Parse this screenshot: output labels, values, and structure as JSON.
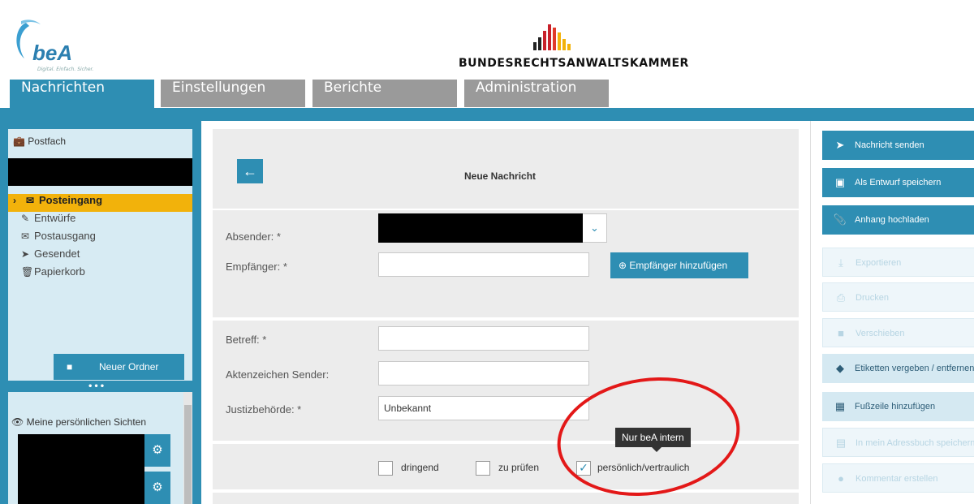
{
  "header": {
    "logo_text": "beA",
    "logo_subtitle": "Digital. Einfach. Sicher.",
    "org_name": "BUNDESRECHTSANWALTSKAMMER",
    "brand_color": "#2e8eb3",
    "accent_color": "#f2b20b"
  },
  "tabs": [
    {
      "label": "Nachrichten"
    },
    {
      "label": "Einstellungen"
    },
    {
      "label": "Berichte"
    },
    {
      "label": "Administration"
    }
  ],
  "sidebar": {
    "postfach_title": "Postfach",
    "folders": [
      {
        "label": "Posteingang",
        "icon": "envelope-icon"
      },
      {
        "label": "Entwürfe",
        "icon": "edit-icon"
      },
      {
        "label": "Postausgang",
        "icon": "open-envelope-icon"
      },
      {
        "label": "Gesendet",
        "icon": "send-icon"
      },
      {
        "label": "Papierkorb",
        "icon": "trash-icon"
      }
    ],
    "new_folder_label": "Neuer Ordner",
    "views_title": "Meine persönlichen Sichten"
  },
  "form": {
    "title": "Neue Nachricht",
    "absender_label": "Absender: *",
    "empfaenger_label": "Empfänger: *",
    "add_recipient_label": "Empfänger hinzufügen",
    "betreff_label": "Betreff: *",
    "aktenzeichen_label": "Aktenzeichen Sender:",
    "justiz_label": "Justizbehörde: *",
    "justiz_value": "Unbekannt",
    "checkboxes": [
      {
        "label": "dringend",
        "checked": false
      },
      {
        "label": "zu prüfen",
        "checked": false
      },
      {
        "label": "persönlich/vertraulich",
        "checked": true
      }
    ],
    "tooltip": "Nur beA intern"
  },
  "actions": [
    {
      "label": "Nachricht senden",
      "icon": "paper-plane-icon",
      "state": "primary"
    },
    {
      "label": "Als Entwurf speichern",
      "icon": "save-icon",
      "state": "primary"
    },
    {
      "label": "Anhang hochladen",
      "icon": "paperclip-icon",
      "state": "primary"
    },
    {
      "label": "Exportieren",
      "icon": "download-icon",
      "state": "disabled"
    },
    {
      "label": "Drucken",
      "icon": "printer-icon",
      "state": "disabled"
    },
    {
      "label": "Verschieben",
      "icon": "folder-move-icon",
      "state": "disabled"
    },
    {
      "label": "Etiketten vergeben / entfernen",
      "icon": "tags-icon",
      "state": "light"
    },
    {
      "label": "Fußzeile hinzufügen",
      "icon": "footer-doc-icon",
      "state": "light"
    },
    {
      "label": "In mein Adressbuch speichern",
      "icon": "address-book-icon",
      "state": "disabled"
    },
    {
      "label": "Kommentar erstellen",
      "icon": "comment-icon",
      "state": "disabled"
    }
  ]
}
